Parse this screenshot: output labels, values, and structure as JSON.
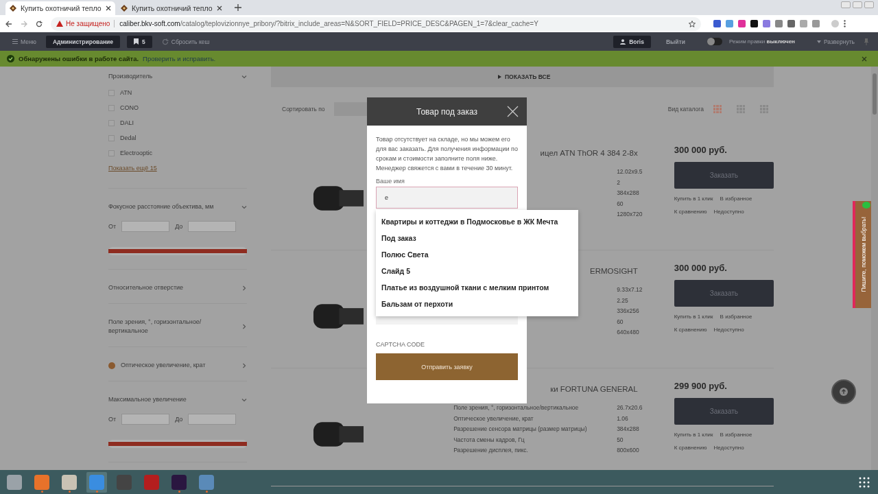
{
  "browser": {
    "tabs": [
      {
        "title": "Купить охотничий тепло",
        "selected": true
      },
      {
        "title": "Купить охотничий тепло",
        "selected": false
      }
    ],
    "security": "Не защищено",
    "url_host": "caliber.bkv-soft.com",
    "url_path": "/catalog/teplovizionnye_pribory/?bitrix_include_areas=N&SORT_FIELD=PRICE_DESC&PAGEN_1=7&clear_cache=Y"
  },
  "admin_bar": {
    "menu": "Меню",
    "admin": "Администрирование",
    "count": "5",
    "reset_cache": "Сбросить кеш",
    "user": "Boris",
    "logout": "Выйти",
    "edit_mode_on": false,
    "edit_mode_label": "Режим правки **выключен**",
    "expand": "Развернуть"
  },
  "alert": {
    "text": "Обнаружены ошибки в работе сайта.",
    "link": "Проверить и исправить."
  },
  "sidebar": {
    "filters": [
      {
        "kind": "checklist",
        "title": "Производитель",
        "expanded": true,
        "marked": false,
        "options": [
          {
            "label": "ATN",
            "checked": false
          },
          {
            "label": "CONO",
            "checked": false
          },
          {
            "label": "DALI",
            "checked": false
          },
          {
            "label": "Dedal",
            "checked": false
          },
          {
            "label": "Electrooptic",
            "checked": false
          }
        ],
        "more": "Показать ещё 15"
      },
      {
        "kind": "range",
        "title": "Фокусное расстояние объектива, мм",
        "expanded": true,
        "marked": false,
        "from": "От",
        "to": "До",
        "level": 1
      },
      {
        "kind": "collapsed",
        "title": "Относительное отверстие",
        "expanded": false,
        "marked": false
      },
      {
        "kind": "collapsed",
        "title": "Поле зрения, °, горизонтальное/ вертикальное",
        "expanded": false,
        "marked": false
      },
      {
        "kind": "collapsed",
        "title": "Оптическое увеличение, крат",
        "expanded": false,
        "marked": true
      },
      {
        "kind": "range",
        "title": "Максимальное увеличение",
        "expanded": true,
        "marked": false,
        "from": "От",
        "to": "До",
        "level": 1
      }
    ]
  },
  "catalog": {
    "show_all": "ПОКАЗАТЬ ВСЕ",
    "sort_label": "Сортировать по",
    "view_label": "Вид каталога",
    "view_modes": [
      {
        "selected": true
      },
      {
        "selected": false
      },
      {
        "selected": false
      }
    ],
    "products": [
      {
        "title": "ицел ATN ThOR 4 384 2-8x",
        "specs": [
          {
            "value": "12.02x9.5"
          },
          {
            "value": "2"
          },
          {
            "value": "384x288"
          },
          {
            "value": "60"
          },
          {
            "value": "1280x720"
          }
        ],
        "price": "300 000 руб.",
        "order": "Заказать",
        "one_click": "Купить в 1 клик",
        "favorite": "В избранное",
        "compare": "К сравнению",
        "availability": "Недоступно"
      },
      {
        "title": "ERMOSIGHT",
        "specs": [
          {
            "value": "9.33x7.12"
          },
          {
            "value": "2.25"
          },
          {
            "value": "336x256"
          },
          {
            "value": "60"
          },
          {
            "value": "640x480"
          }
        ],
        "price": "300 000 руб.",
        "order": "Заказать",
        "one_click": "Купить в 1 клик",
        "favorite": "В избранное",
        "compare": "К сравнению",
        "availability": "Недоступно"
      },
      {
        "title": "ки FORTUNA GENERAL",
        "specs": [
          {
            "label": "Поле зрения, °, горизонтальное/вертикальное",
            "value": "26.7x20.6"
          },
          {
            "label": "Оптическое увеличение, крат",
            "value": "1.06"
          },
          {
            "label": "Разрешение сенсора матрицы (размер матрицы)",
            "value": "384x288"
          },
          {
            "label": "Частота смены кадров, Гц",
            "value": "50"
          },
          {
            "label": "Разрешение дисплея, пикс.",
            "value": "800x600"
          }
        ],
        "price": "299 900 руб.",
        "order": "Заказать",
        "one_click": "Купить в 1 клик",
        "favorite": "В избранное",
        "compare": "К сравнению",
        "availability": "Недоступно"
      }
    ]
  },
  "side_tab": "Пишите, поможем выбрать!",
  "modal": {
    "title": "Товар под заказ",
    "text": "Товар отсутствует на складе, но мы можем его для вас заказать. Для получения информации по срокам и стоимости заполните поля ниже. Менеджер свяжется с вами в течение 30 минут.",
    "name_label": "Ваше имя",
    "name_value": "e",
    "name_error": true,
    "captcha_label": "CAPTCHA CODE",
    "submit": "Отправить заявку",
    "suggestions": [
      "Квартиры и коттеджи в Подмосковье в ЖК Мечта",
      "Под заказ",
      "Полюс Света",
      "Слайд 5",
      "Платье из воздушной ткани с мелким принтом",
      "Бальзам от перхоти"
    ]
  },
  "taskbar": {
    "apps": [
      {
        "kind": "tools",
        "running": false,
        "selected": false
      },
      {
        "kind": "store",
        "running": true,
        "selected": false
      },
      {
        "kind": "files",
        "running": true,
        "selected": false
      },
      {
        "kind": "browser",
        "running": true,
        "selected": true
      },
      {
        "kind": "editor",
        "running": false,
        "selected": false
      },
      {
        "kind": "ftp",
        "running": false,
        "selected": false
      },
      {
        "kind": "ide",
        "running": true,
        "selected": false
      },
      {
        "kind": "monitor",
        "running": true,
        "selected": false
      }
    ]
  }
}
